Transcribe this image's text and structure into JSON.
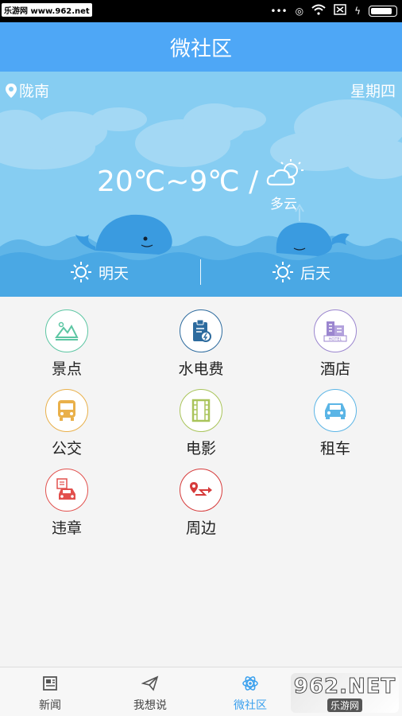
{
  "status_bar": {
    "watermark": "乐游网 www.962.net"
  },
  "header": {
    "title": "微社区"
  },
  "weather": {
    "location": "陇南",
    "weekday": "星期四",
    "temperature": "20℃~9℃ /",
    "condition": "多云",
    "tomorrow": "明天",
    "day_after": "后天"
  },
  "services": [
    {
      "label": "景点",
      "icon": "scenery-icon",
      "color": "#5cc6a3"
    },
    {
      "label": "水电费",
      "icon": "utility-bill-icon",
      "color": "#2d6b9e"
    },
    {
      "label": "酒店",
      "icon": "hotel-icon",
      "color": "#9b86cf"
    },
    {
      "label": "公交",
      "icon": "bus-icon",
      "color": "#e9b04a"
    },
    {
      "label": "电影",
      "icon": "film-icon",
      "color": "#a9c45a"
    },
    {
      "label": "租车",
      "icon": "car-rental-icon",
      "color": "#5bb5e6"
    },
    {
      "label": "违章",
      "icon": "traffic-violation-icon",
      "color": "#e2504d"
    },
    {
      "label": "周边",
      "icon": "nearby-route-icon",
      "color": "#d63b3b"
    }
  ],
  "tabs": [
    {
      "label": "新闻",
      "icon": "news-icon"
    },
    {
      "label": "我想说",
      "icon": "paper-plane-icon"
    },
    {
      "label": "微社区",
      "icon": "community-icon",
      "active": true
    }
  ],
  "watermark_bottom": {
    "big": "962.NET",
    "small": "乐游网"
  },
  "colors": {
    "header": "#4ea7f6",
    "weather_bg": "#86cdf2",
    "active_tab": "#3aa0ee"
  }
}
